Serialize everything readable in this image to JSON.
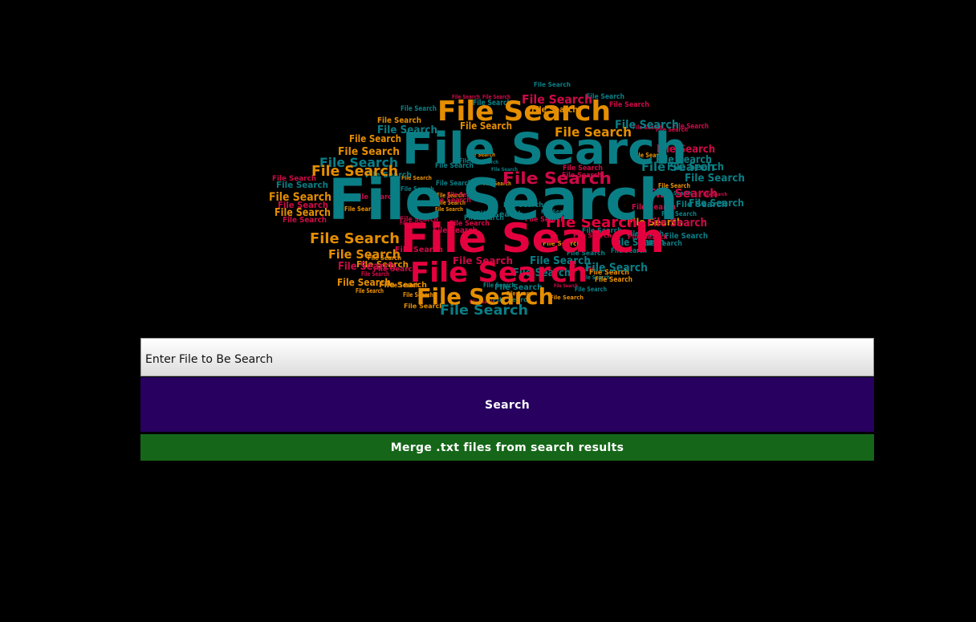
{
  "wordcloud": {
    "word": "File Search",
    "colors": [
      "#0a7e85",
      "#e4003e",
      "#e58e00",
      "#cc0a47"
    ]
  },
  "search": {
    "placeholder": "Enter File to Be Search",
    "value": ""
  },
  "buttons": {
    "search_label": "Search",
    "merge_label": "Merge .txt files from search results"
  }
}
